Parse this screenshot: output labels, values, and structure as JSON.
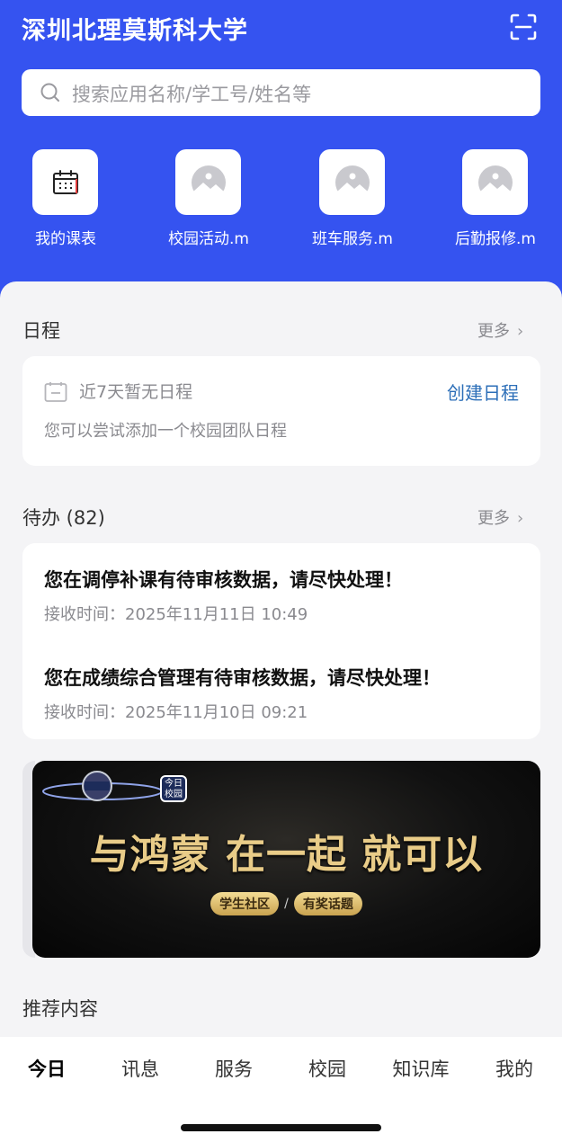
{
  "header": {
    "school_name": "深圳北理莫斯科大学",
    "search_placeholder": "搜索应用名称/学工号/姓名等"
  },
  "quick_apps": [
    {
      "label": "我的课表",
      "icon": "calendar-icon"
    },
    {
      "label": "校园活动.m",
      "icon": "image-placeholder-icon"
    },
    {
      "label": "班车服务.m",
      "icon": "image-placeholder-icon"
    },
    {
      "label": "后勤报修.m",
      "icon": "image-placeholder-icon"
    }
  ],
  "schedule": {
    "title": "日程",
    "more": "更多",
    "empty_text": "近7天暂无日程",
    "create_label": "创建日程",
    "hint": "您可以尝试添加一个校园团队日程"
  },
  "todo": {
    "title": "待办 (82)",
    "more": "更多",
    "items": [
      {
        "title": "您在调停补课有待审核数据，请尽快处理！",
        "time": "接收时间：2025年11月11日 10:49"
      },
      {
        "title": "您在成绩综合管理有待审核数据，请尽快处理！",
        "time": "接收时间：2025年11月10日 09:21"
      }
    ]
  },
  "banner": {
    "tag": "今日校园",
    "slogan": "与鸿蒙 在一起 就可以",
    "pills": [
      "学生社区",
      "有奖话题"
    ],
    "separator": "/"
  },
  "recommend": {
    "title": "推荐内容"
  },
  "tabs": [
    {
      "label": "今日",
      "active": true
    },
    {
      "label": "讯息",
      "active": false
    },
    {
      "label": "服务",
      "active": false
    },
    {
      "label": "校园",
      "active": false
    },
    {
      "label": "知识库",
      "active": false
    },
    {
      "label": "我的",
      "active": false
    }
  ],
  "colors": {
    "header_blue": "#3553f0",
    "link_blue": "#2d6fb8",
    "banner_gold": "#e9cc88"
  }
}
